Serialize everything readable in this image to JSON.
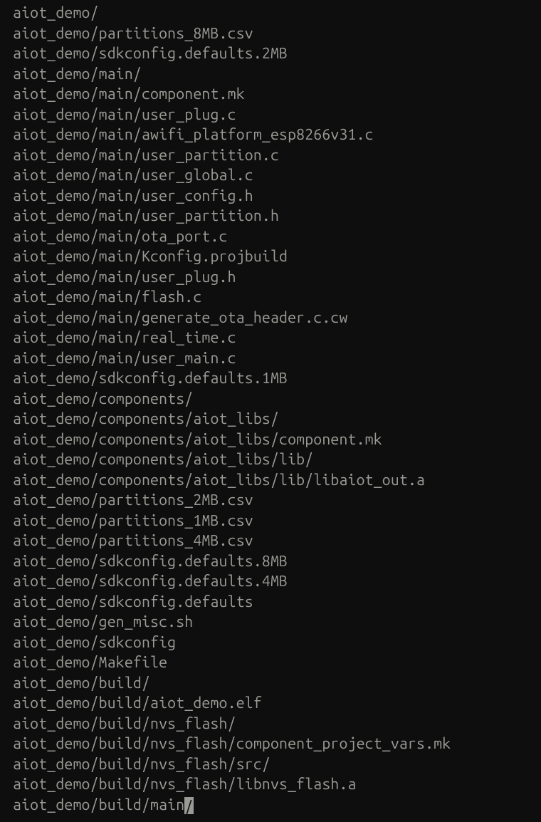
{
  "terminal": {
    "lines": [
      "aiot_demo/",
      "aiot_demo/partitions_8MB.csv",
      "aiot_demo/sdkconfig.defaults.2MB",
      "aiot_demo/main/",
      "aiot_demo/main/component.mk",
      "aiot_demo/main/user_plug.c",
      "aiot_demo/main/awifi_platform_esp8266v31.c",
      "aiot_demo/main/user_partition.c",
      "aiot_demo/main/user_global.c",
      "aiot_demo/main/user_config.h",
      "aiot_demo/main/user_partition.h",
      "aiot_demo/main/ota_port.c",
      "aiot_demo/main/Kconfig.projbuild",
      "aiot_demo/main/user_plug.h",
      "aiot_demo/main/flash.c",
      "aiot_demo/main/generate_ota_header.c.cw",
      "aiot_demo/main/real_time.c",
      "aiot_demo/main/user_main.c",
      "aiot_demo/sdkconfig.defaults.1MB",
      "aiot_demo/components/",
      "aiot_demo/components/aiot_libs/",
      "aiot_demo/components/aiot_libs/component.mk",
      "aiot_demo/components/aiot_libs/lib/",
      "aiot_demo/components/aiot_libs/lib/libaiot_out.a",
      "aiot_demo/partitions_2MB.csv",
      "aiot_demo/partitions_1MB.csv",
      "aiot_demo/partitions_4MB.csv",
      "aiot_demo/sdkconfig.defaults.8MB",
      "aiot_demo/sdkconfig.defaults.4MB",
      "aiot_demo/sdkconfig.defaults",
      "aiot_demo/gen_misc.sh",
      "aiot_demo/sdkconfig",
      "aiot_demo/Makefile",
      "aiot_demo/build/",
      "aiot_demo/build/aiot_demo.elf",
      "aiot_demo/build/nvs_flash/",
      "aiot_demo/build/nvs_flash/component_project_vars.mk",
      "aiot_demo/build/nvs_flash/src/",
      "aiot_demo/build/nvs_flash/libnvs_flash.a"
    ],
    "last_line_prefix": "aiot_demo/build/main",
    "cursor_char": "/"
  }
}
